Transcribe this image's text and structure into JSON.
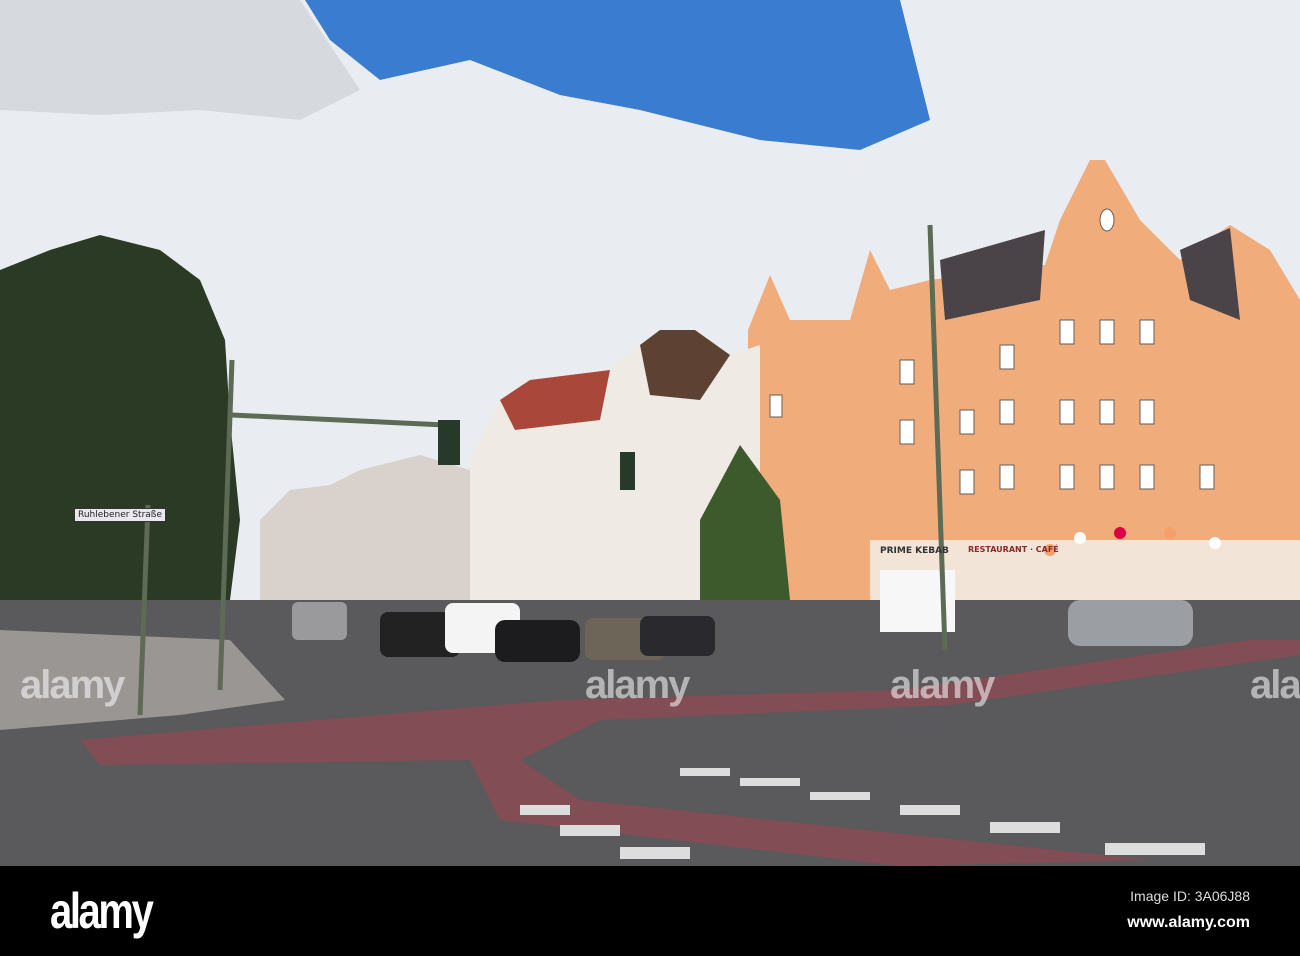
{
  "photo": {
    "street_sign": "Ruhlebener Straße",
    "shop_signs": [
      "PRIME KEBAB",
      "RESTAURANT · CAFÉ"
    ]
  },
  "watermark": {
    "text": "alamy"
  },
  "footer": {
    "logo": "alamy",
    "image_id": "Image ID: 3A06J88",
    "website": "www.alamy.com"
  }
}
